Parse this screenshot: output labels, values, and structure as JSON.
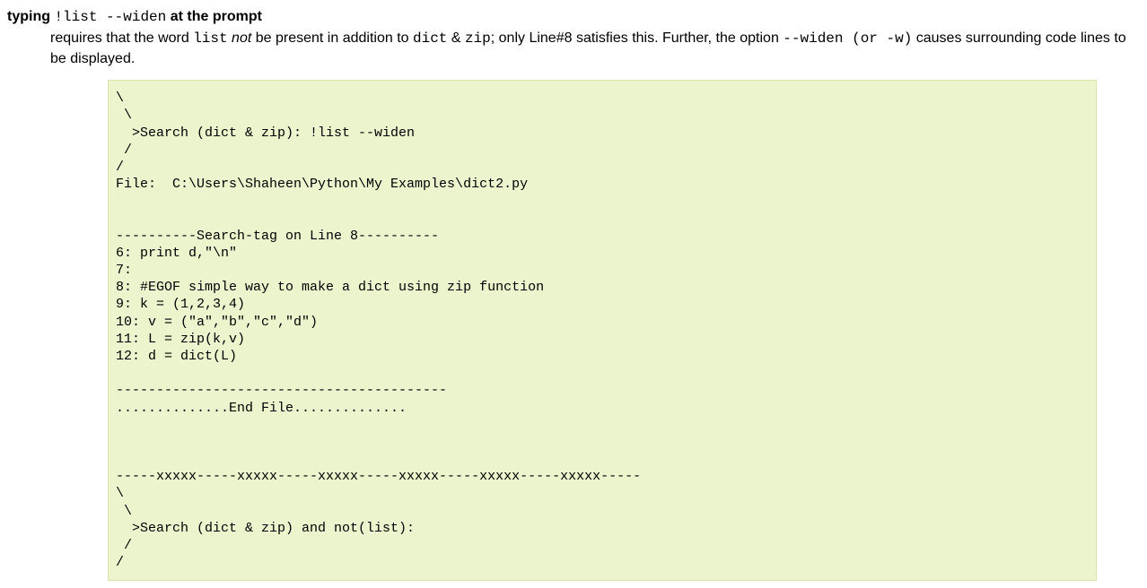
{
  "heading": {
    "prefix": "typing ",
    "code": "!list --widen",
    "suffix": " at the prompt"
  },
  "description": {
    "part1": "requires that the word ",
    "code1": "list",
    "italic1": " not",
    "part2": " be present in addition to ",
    "code2": "dict",
    "part3": " & ",
    "code3": "zip",
    "part4": "; only Line#8 satisfies this. Further, the option ",
    "code4": "--widen (or -w)",
    "part5": " causes surrounding code lines to be displayed."
  },
  "code_block": "\\\n \\\n  >Search (dict & zip): !list --widen\n /\n/\nFile:  C:\\Users\\Shaheen\\Python\\My Examples\\dict2.py\n\n\n----------Search-tag on Line 8----------\n6: print d,\"\\n\"\n7:\n8: #EGOF simple way to make a dict using zip function\n9: k = (1,2,3,4)\n10: v = (\"a\",\"b\",\"c\",\"d\")\n11: L = zip(k,v)\n12: d = dict(L)\n\n-----------------------------------------\n..............End File..............\n\n\n\n-----xxxxx-----xxxxx-----xxxxx-----xxxxx-----xxxxx-----xxxxx-----\n\\\n \\\n  >Search (dict & zip) and not(list):\n /\n/"
}
